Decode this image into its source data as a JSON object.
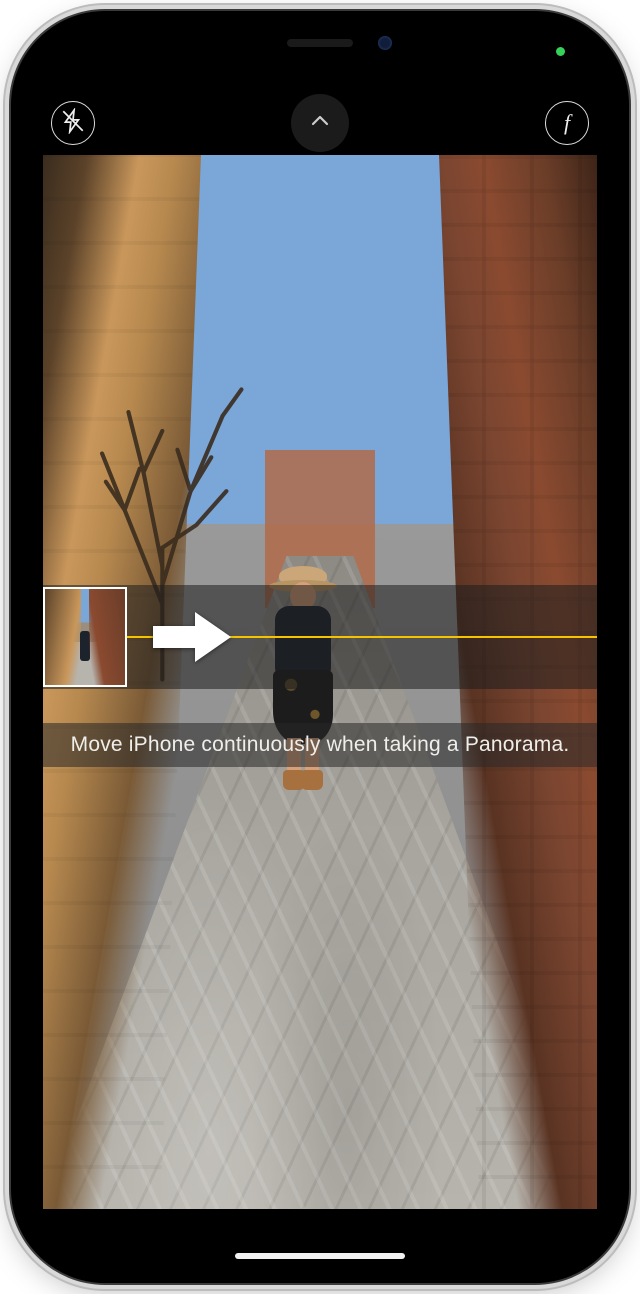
{
  "camera": {
    "mode": "PANO",
    "hint": "Move iPhone continuously when taking a Panorama.",
    "flash_state": "off",
    "guide_line_color": "#f5c300"
  },
  "icons": {
    "flash": "flash-off-icon",
    "expand": "chevron-up-icon",
    "aperture": "f-number-icon",
    "arrow": "arrow-right-icon"
  },
  "status": {
    "privacy_indicator": "camera-active"
  }
}
